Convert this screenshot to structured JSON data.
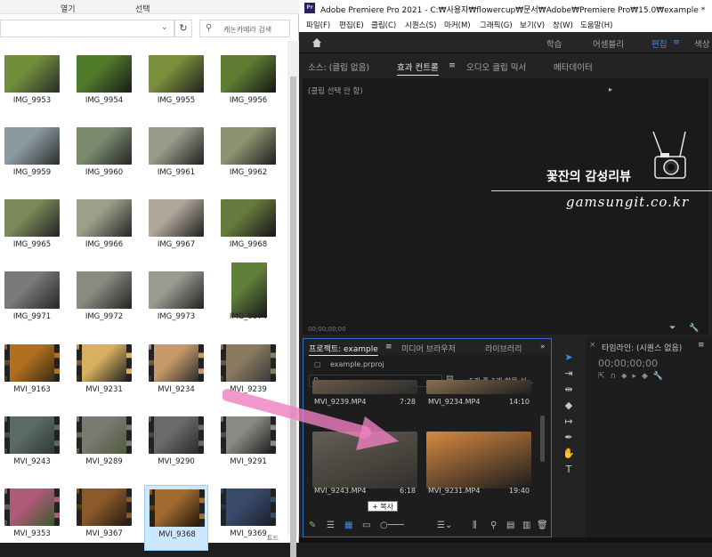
{
  "explorer": {
    "ribbon_tabs": [
      "",
      "열기",
      "선택"
    ],
    "search_placeholder": "캐논카메라 검색",
    "status_text": "트드",
    "files": [
      {
        "name": "IMG_9953",
        "c1": "#6f8f3a",
        "c2": "#2a2a2a"
      },
      {
        "name": "IMG_9954",
        "c1": "#4f7a2a",
        "c2": "#1b1b1b"
      },
      {
        "name": "IMG_9955",
        "c1": "#7a8e3c",
        "c2": "#202020"
      },
      {
        "name": "IMG_9956",
        "c1": "#5e7d33",
        "c2": "#161616"
      },
      {
        "name": "IMG_9959",
        "c1": "#8a9aa0",
        "c2": "#2d2d2d"
      },
      {
        "name": "IMG_9960",
        "c1": "#7b8c6e",
        "c2": "#262626"
      },
      {
        "name": "IMG_9961",
        "c1": "#9a9a8a",
        "c2": "#202020"
      },
      {
        "name": "IMG_9962",
        "c1": "#8f9270",
        "c2": "#1e1e1e"
      },
      {
        "name": "IMG_9965",
        "c1": "#7c8a5a",
        "c2": "#222222"
      },
      {
        "name": "IMG_9966",
        "c1": "#9aa08a",
        "c2": "#252525"
      },
      {
        "name": "IMG_9967",
        "c1": "#b0a89a",
        "c2": "#1f1f1f"
      },
      {
        "name": "IMG_9968",
        "c1": "#667a3e",
        "c2": "#151515"
      },
      {
        "name": "IMG_9971",
        "c1": "#7a7a7a",
        "c2": "#262626"
      },
      {
        "name": "IMG_9972",
        "c1": "#8a8a80",
        "c2": "#232323"
      },
      {
        "name": "IMG_9973",
        "c1": "#9a9a90",
        "c2": "#222222"
      },
      {
        "name": "IMG_9974",
        "c1": "#5f7e3a",
        "c2": "#181818"
      },
      {
        "name": "MVI_9163",
        "c1": "#b0701e",
        "c2": "#3a2a18"
      },
      {
        "name": "MVI_9231",
        "c1": "#d8b060",
        "c2": "#222222"
      },
      {
        "name": "MVI_9234",
        "c1": "#c89a6a",
        "c2": "#2b2b2b"
      },
      {
        "name": "MVI_9239",
        "c1": "#8a7a60",
        "c2": "#3a3a3a"
      },
      {
        "name": "MVI_9243",
        "c1": "#5a6a66",
        "c2": "#2f3a38"
      },
      {
        "name": "MVI_9289",
        "c1": "#7a7a72",
        "c2": "#4f5a3a"
      },
      {
        "name": "MVI_9290",
        "c1": "#6a6a6a",
        "c2": "#2a2a2a"
      },
      {
        "name": "MVI_9291",
        "c1": "#8a8a84",
        "c2": "#202020"
      },
      {
        "name": "MVI_9353",
        "c1": "#b05a7a",
        "c2": "#3a5a2a"
      },
      {
        "name": "MVI_9367",
        "c1": "#8a5a2a",
        "c2": "#2a1a10"
      },
      {
        "name": "MVI_9368",
        "c1": "#a06a30",
        "c2": "#241608"
      },
      {
        "name": "MVI_9369",
        "c1": "#3a4a6a",
        "c2": "#1a2030"
      }
    ],
    "selected_file": "MVI_9368"
  },
  "premiere": {
    "title": "Adobe Premiere Pro 2021 - C:₩사용자₩flowercup₩문서₩Adobe₩Premiere Pro₩15.0₩example *",
    "logo_text": "Pr",
    "menu": [
      "파일(F)",
      "편집(E)",
      "클립(C)",
      "시퀀스(S)",
      "마커(M)",
      "그래픽(G)",
      "보기(V)",
      "창(W)",
      "도움말(H)"
    ],
    "workspaces": [
      "학습",
      "어셈블리",
      "편집",
      "색상"
    ],
    "active_workspace": "편집",
    "source_tabs": [
      "소스: (클립 없음)",
      "효과 컨트롤",
      "오디오 클립 믹서",
      "메타데이터"
    ],
    "clip_selection": "(클립 선택 안 함)",
    "source_timecode": "00;00;00;00",
    "watermark_title": "꽃잔의 감성리뷰",
    "watermark_url": "gamsungit.co.kr",
    "project_tabs": [
      "프로젝트: example",
      "미디어 브라우저",
      "라이브러리"
    ],
    "project_file": "example.prproj",
    "item_count": "5개 중 1개 항목 선...",
    "clips": [
      {
        "name": "MVI_9239.MP4",
        "duration": "7:28",
        "c1": "#6a5a4a",
        "c2": "#2a2a2a"
      },
      {
        "name": "MVI_9234.MP4",
        "duration": "14:10",
        "c1": "#8a7050",
        "c2": "#1f1f1f"
      },
      {
        "name": "MVI_9243.MP4",
        "duration": "6:18",
        "c1": "#7a7468",
        "c2": "#3a3630"
      },
      {
        "name": "MVI_9231.MP4",
        "duration": "19:40",
        "c1": "#d88a40",
        "c2": "#1c1c1c"
      }
    ],
    "copy_badge": "+ 복사",
    "timeline_title": "타임라인: (시퀀스 없음)",
    "timeline_code": "00;00;00;00"
  }
}
